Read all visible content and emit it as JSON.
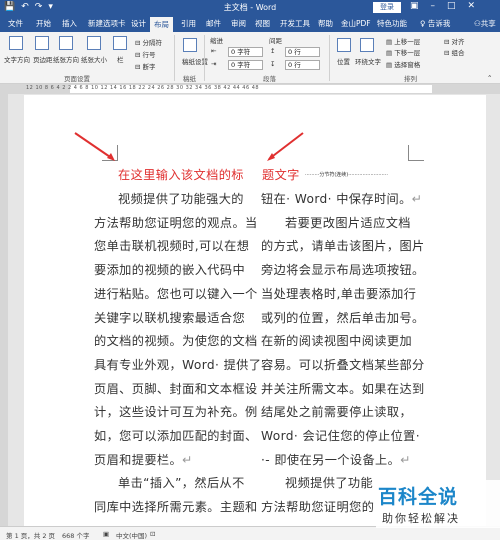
{
  "window": {
    "title": "主文档 - Word",
    "login": "登录"
  },
  "tabs": [
    "文件",
    "开始",
    "插入",
    "新建选项卡",
    "设计",
    "布局",
    "引用",
    "邮件",
    "审阅",
    "视图",
    "开发工具",
    "帮助",
    "金山PDF",
    "特色功能"
  ],
  "active_tab": "布局",
  "tell_me": "告诉我",
  "share": "共享",
  "ribbon": {
    "buttons": [
      "文字方向",
      "页边距",
      "纸张方向",
      "纸张大小",
      "栏"
    ],
    "small": [
      "分隔符",
      "行号",
      "断字"
    ],
    "draft": "稿纸设置",
    "draft_group": "稿纸",
    "page_setup": "页面设置",
    "indent": "缩进",
    "spacing": "间距",
    "indent_left": "0 字符",
    "indent_right": "0 字符",
    "space_before": "0 行",
    "space_after": "0 行",
    "paragraph": "段落",
    "arrange": "排列",
    "arrange_items": [
      "位置",
      "环绕文字",
      "上移一层",
      "下移一层",
      "选择窗格",
      "对齐",
      "组合"
    ]
  },
  "ruler_numbers": "12 10 8 6 4 2   2 4 6 8 10 12 14 16 18   22 24 26 28 30 32 34 36 38   42 44 46 48",
  "doc": {
    "title_left": "在这里输入该文档的标",
    "title_right": "题文字",
    "col_break": "分节符(连续)",
    "para_mark": "↵",
    "left": [
      "视频提供了功能强大的",
      "方法帮助您证明您的观点。当",
      "您单击联机视频时,可以在想",
      "要添加的视频的嵌入代码中",
      "进行粘贴。您也可以键入一个",
      "关键字以联机搜索最适合您",
      "的文档的视频。为使您的文档",
      "具有专业外观，Word· 提供了",
      "页眉、页脚、封面和文本框设",
      "计，这些设计可互为补充。例",
      "如，您可以添加匹配的封面、",
      "页眉和提要栏。",
      "单击“插入”，然后从不",
      "同库中选择所需元素。主题和"
    ],
    "right": [
      "钮在· Word· 中保存时间。",
      "若要更改图片适应文档",
      "的方式，请单击该图片，图片",
      "旁边将会显示布局选项按钮。",
      "当处理表格时,单击要添加行",
      "或列的位置，然后单击加号。",
      "在新的阅读视图中阅读更加",
      "容易。可以折叠文档某些部分",
      "并关注所需文本。如果在达到",
      "结尾处之前需要停止读取，",
      "Word· 会记住您的停止位置·",
      "·- 即使在另一个设备上。",
      "视频提供了功能",
      "方法帮助您证明您的"
    ]
  },
  "status": {
    "page": "第 1 页，共 2 页",
    "words": "668 个字",
    "lang": "中文(中国)"
  },
  "watermark": {
    "line1": "百科全说",
    "line2": "助你轻松解决"
  },
  "colors": {
    "accent": "#2b579a",
    "title_text": "#e03030",
    "watermark": "#1c86c9"
  }
}
